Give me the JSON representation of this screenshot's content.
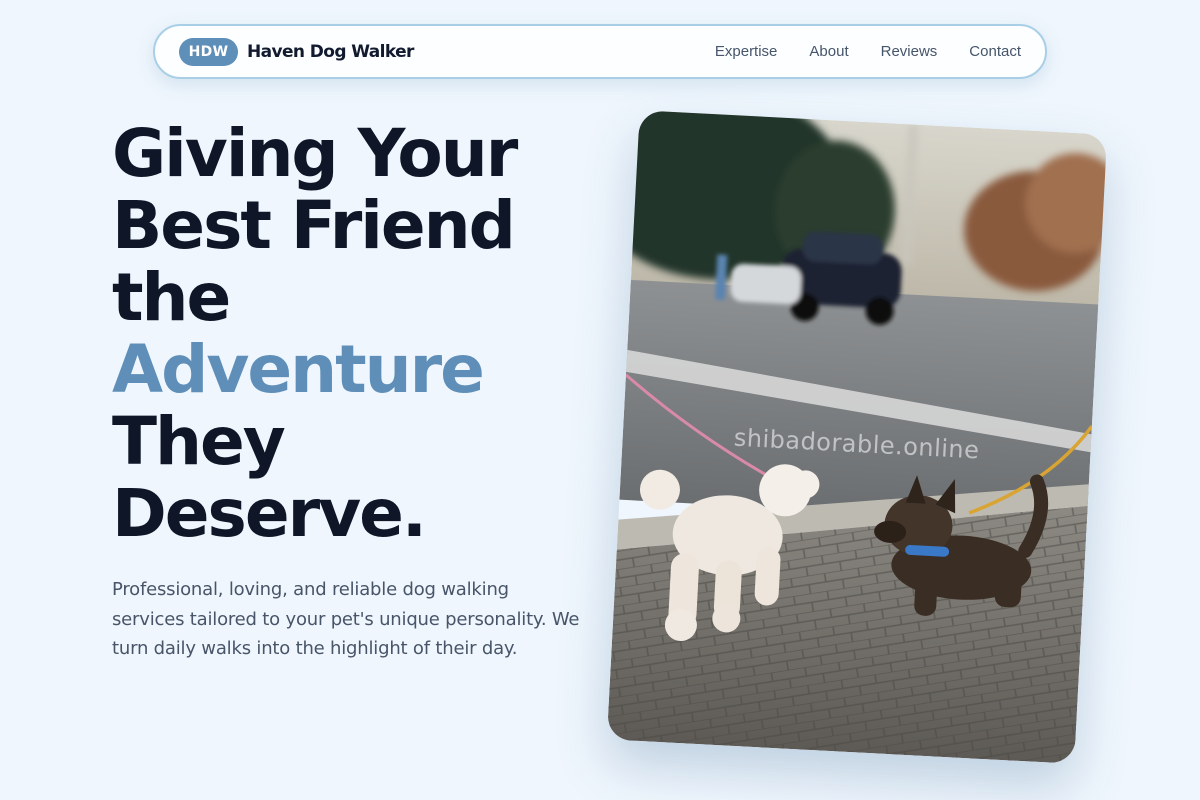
{
  "brand": {
    "badge": "HDW",
    "name": "Haven Dog Walker"
  },
  "nav": {
    "links": [
      "Expertise",
      "About",
      "Reviews",
      "Contact"
    ]
  },
  "hero": {
    "headline_lines": [
      "Giving Your",
      "Best Friend",
      "the"
    ],
    "headline_accent": "Adventure",
    "headline_end_lines": [
      "They",
      "Deserve."
    ],
    "subcopy": "Professional, loving, and reliable dog walking services tailored to your pet's unique personality. We turn daily walks into the highlight of their day.",
    "photo_watermark": "shibadorable.online"
  },
  "colors": {
    "background": "#eff6fd",
    "accent": "#5f8fb8",
    "heading": "#0e1628",
    "body_text": "#485569",
    "nav_border": "#a9cfe6"
  },
  "icons": {
    "photo": "dogs-meeting-on-street-photo"
  }
}
